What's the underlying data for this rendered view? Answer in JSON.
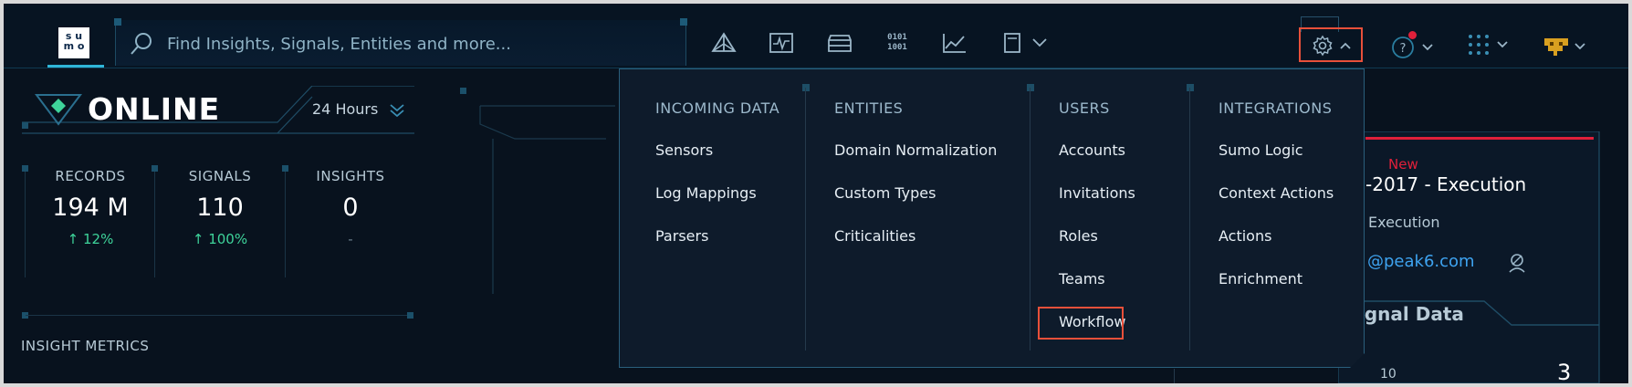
{
  "app": {
    "logo_text": [
      "s u",
      "m o"
    ]
  },
  "search": {
    "placeholder": "Find Insights, Signals, Entities and more..."
  },
  "nav_icons": [
    "triangle-network-icon",
    "pulse-chart-icon",
    "database-icon",
    "binary-icon",
    "line-chart-icon",
    "tablet-icon",
    "chevron-down-icon"
  ],
  "binary_icon_text": [
    "0101",
    "1001"
  ],
  "status": {
    "state": "ONLINE",
    "time_range": "24 Hours"
  },
  "metrics": [
    {
      "label": "RECORDS",
      "value": "194 M",
      "change": "↑ 12%"
    },
    {
      "label": "SIGNALS",
      "value": "110",
      "change": "↑ 100%"
    },
    {
      "label": "INSIGHTS",
      "value": "0",
      "change": "-"
    }
  ],
  "insight_metrics_title": "INSIGHT METRICS",
  "insight_card": {
    "badge": "New",
    "title": "-2017 - Execution",
    "stage": "Execution",
    "email": "@peak6.com",
    "signal_tab": "ignal Data",
    "axis_left": "10",
    "axis_right": "3"
  },
  "settings_menu": {
    "columns": [
      {
        "heading": "INCOMING DATA",
        "items": [
          "Sensors",
          "Log Mappings",
          "Parsers"
        ]
      },
      {
        "heading": "ENTITIES",
        "items": [
          "Domain Normalization",
          "Custom Types",
          "Criticalities"
        ]
      },
      {
        "heading": "USERS",
        "items": [
          "Accounts",
          "Invitations",
          "Roles",
          "Teams",
          "Workflow"
        ]
      },
      {
        "heading": "INTEGRATIONS",
        "items": [
          "Sumo Logic",
          "Context Actions",
          "Actions",
          "Enrichment"
        ]
      }
    ]
  },
  "colors": {
    "background": "#08121e",
    "accent": "#2fb6d8",
    "highlight": "#e8503a",
    "positive": "#3ed39a",
    "link": "#3ea3f0",
    "alert": "#e0203a"
  }
}
